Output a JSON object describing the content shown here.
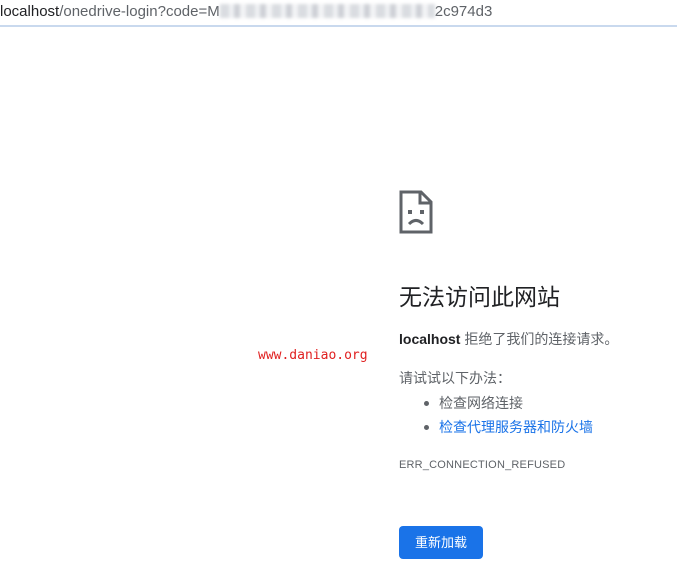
{
  "address_bar": {
    "url_host": "localhost",
    "url_path": "/onedrive-login?code=M",
    "url_tail": "2c974d3"
  },
  "watermark": {
    "text": "www.daniao.org"
  },
  "error_page": {
    "icon": "sad-page-icon",
    "title": "无法访问此网站",
    "host": "localhost",
    "description": " 拒绝了我们的连接请求。",
    "try_label": "请试试以下办法：",
    "suggestions": [
      {
        "label": "检查网络连接",
        "is_link": false
      },
      {
        "label": "检查代理服务器和防火墙",
        "is_link": true
      }
    ],
    "error_code": "ERR_CONNECTION_REFUSED",
    "reload_button": "重新加载",
    "accent_color": "#1a73e8"
  }
}
